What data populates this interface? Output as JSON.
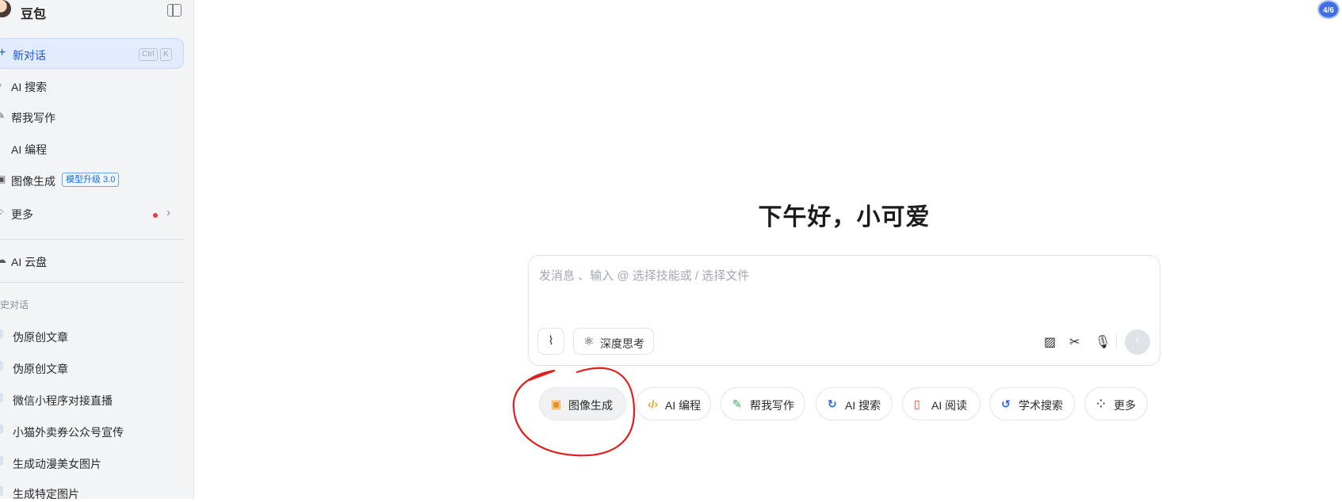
{
  "sidebar": {
    "brand_name": "豆包",
    "new_chat": {
      "label": "新对话",
      "shortcut_keys": [
        "Ctrl",
        "K"
      ]
    },
    "items": [
      {
        "label": "AI 搜索",
        "icon": "search-icon"
      },
      {
        "label": "帮我写作",
        "icon": "pen-icon"
      },
      {
        "label": "AI 编程",
        "icon": "code-icon"
      },
      {
        "label": "图像生成",
        "icon": "image-icon",
        "badge": "模型升级 3.0"
      },
      {
        "label": "更多",
        "icon": "grid-icon",
        "has_red_dot": true
      }
    ],
    "cloud_item": {
      "label": "AI 云盘",
      "icon": "cloud-icon"
    },
    "history_section_label": "史对话",
    "history": [
      "伪原创文章",
      "伪原创文章",
      "微信小程序对接直播",
      "小猫外卖券公众号宣传",
      "生成动漫美女图片",
      "生成特定图片"
    ]
  },
  "main": {
    "greeting": "下午好，小可爱",
    "composer": {
      "placeholder": "发消息 、输入 @ 选择技能或 / 选择文件",
      "value": "",
      "deep_think_label": "深度思考",
      "tools": [
        "screenshot-icon",
        "scissors-icon",
        "microphone-icon"
      ],
      "send_icon": "arrow-up-icon"
    },
    "skills": [
      {
        "label": "图像生成",
        "icon": "image-gen-icon",
        "color": "#f08c1c",
        "selected": true
      },
      {
        "label": "AI 编程",
        "icon": "code-icon",
        "color": "#f0a020"
      },
      {
        "label": "帮我写作",
        "icon": "pen-icon",
        "color": "#2fa85a"
      },
      {
        "label": "AI 搜索",
        "icon": "search-icon",
        "color": "#2563eb"
      },
      {
        "label": "AI 阅读",
        "icon": "book-icon",
        "color": "#e53935"
      },
      {
        "label": "学术搜索",
        "icon": "academic-icon",
        "color": "#2563eb"
      },
      {
        "label": "更多",
        "icon": "grid-icon",
        "color": "#4b5a7a"
      }
    ]
  },
  "corner_badge": "4/6",
  "colors": {
    "accent": "#1a56db",
    "annotation": "#e0201e"
  }
}
